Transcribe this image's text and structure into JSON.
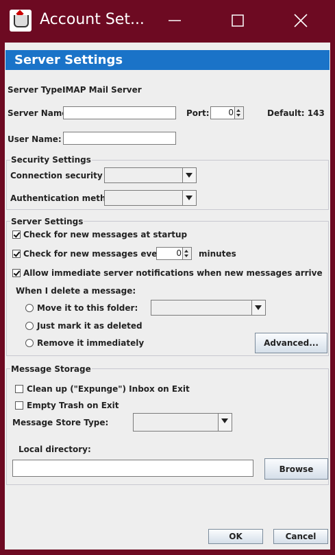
{
  "window": {
    "title": "Account Set...",
    "controls": {
      "minimize": "minimize-icon",
      "maximize": "maximize-icon",
      "close": "close-icon"
    }
  },
  "header": {
    "title": "Server Settings"
  },
  "server": {
    "type_label": "Server Type:",
    "type_value": "IMAP Mail Server",
    "name_label": "Server Name:",
    "name_value": "",
    "port_label": "Port:",
    "port_value": "0",
    "default_label": "Default: 143",
    "user_label": "User Name:",
    "user_value": ""
  },
  "security": {
    "title": "Security Settings",
    "connection_label": "Connection security",
    "connection_value": "",
    "auth_label": "Authentication method",
    "auth_value": ""
  },
  "server_settings": {
    "title": "Server Settings",
    "check_startup": {
      "label": "Check for new messages at startup",
      "checked": true
    },
    "check_every": {
      "label": "Check for new messages every",
      "checked": true,
      "value": "0",
      "unit": "minutes"
    },
    "allow_notifications": {
      "label": "Allow immediate server notifications when new messages arrive",
      "checked": true
    },
    "delete_label": "When I delete a message:",
    "delete_options": [
      {
        "label": "Move it to this folder:"
      },
      {
        "label": "Just mark it as deleted"
      },
      {
        "label": "Remove it immediately"
      }
    ],
    "folder_value": "",
    "advanced_button": "Advanced..."
  },
  "storage": {
    "title": "Message Storage",
    "cleanup": {
      "label": "Clean up (\"Expunge\") Inbox on Exit",
      "checked": false
    },
    "empty_trash": {
      "label": "Empty Trash on Exit",
      "checked": false
    },
    "store_type_label": "Message Store Type:",
    "store_type_value": "",
    "local_dir_label": "Local directory:",
    "local_dir_value": "",
    "browse_button": "Browse"
  },
  "footer": {
    "ok_button": "OK",
    "cancel_button": "Cancel"
  },
  "colors": {
    "titlebar": "#6d0a22",
    "header": "#1a73c8",
    "panel": "#eeeeee"
  }
}
